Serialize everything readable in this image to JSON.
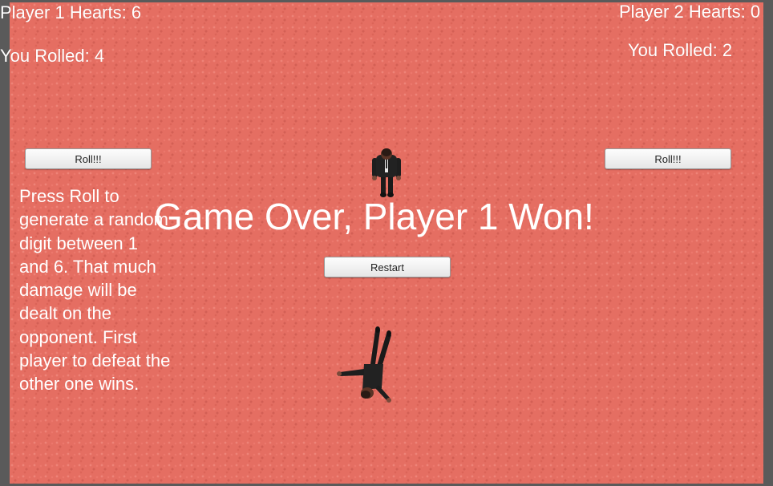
{
  "hud": {
    "player1_hearts": "Player 1 Hearts: 6",
    "player1_rolled": "You Rolled: 4",
    "player2_hearts": "Player 2 Hearts: 0",
    "player2_rolled": "You Rolled: 2"
  },
  "buttons": {
    "player1_roll": "Roll!!!",
    "player2_roll": "Roll!!!",
    "restart": "Restart"
  },
  "instructions": "Press Roll to generate a random digit between 1 and 6. That much damage will be dealt on the opponent. First player to defeat the other one wins.",
  "game_over_text": "Game Over, Player 1 Won!",
  "colors": {
    "background": "#e56e62",
    "text": "#ffffff",
    "frame": "#5a5a5a"
  },
  "figures": {
    "player1": "standing-man-in-suit",
    "player2": "fallen-man-in-suit"
  }
}
